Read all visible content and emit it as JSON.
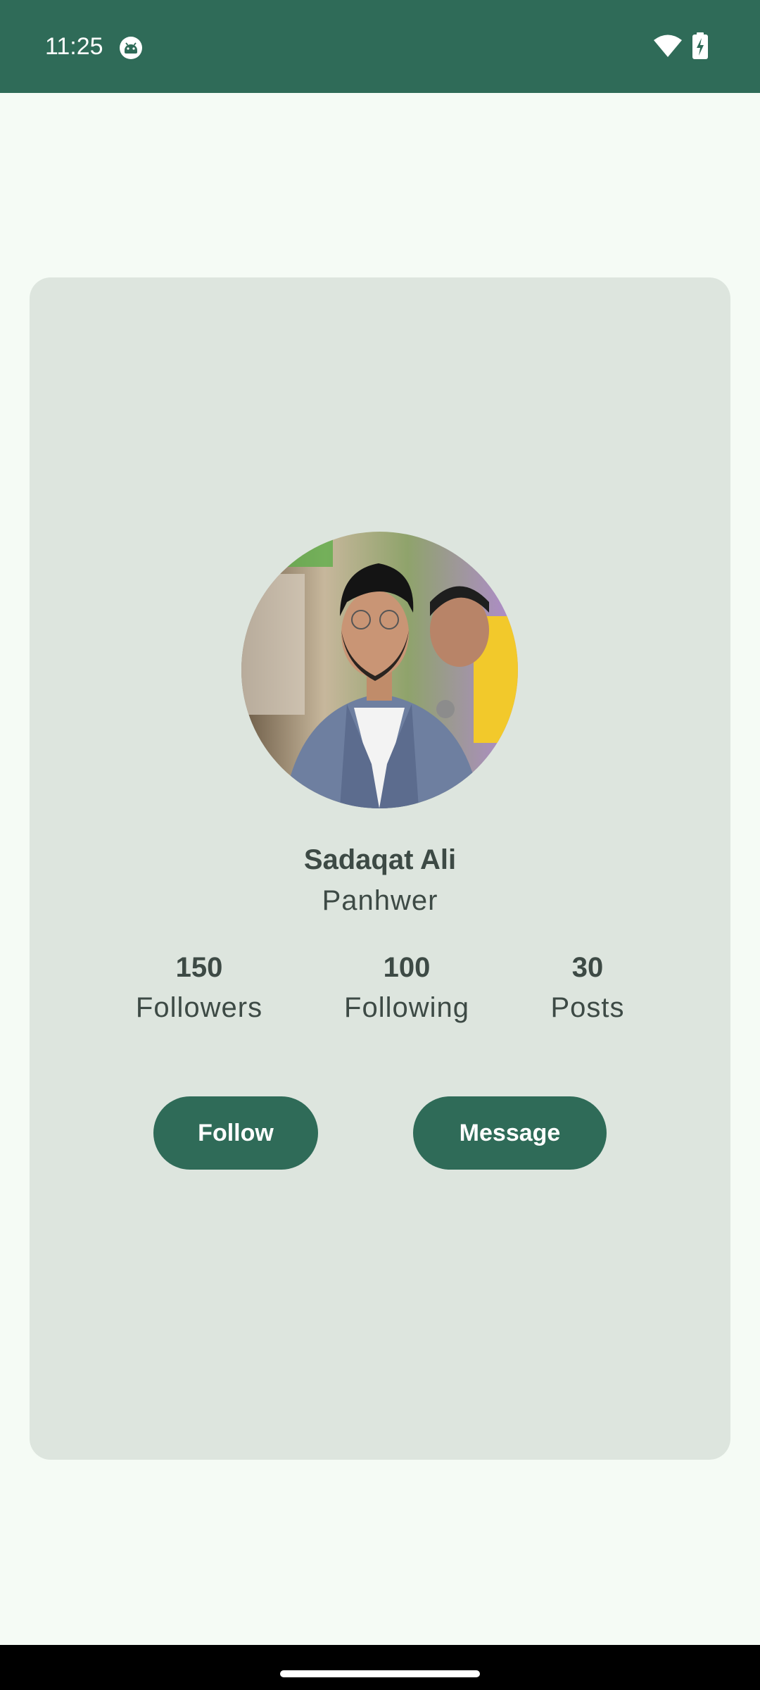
{
  "status_bar": {
    "time": "11:25",
    "app_icon": "android-robot-icon",
    "wifi_icon": "wifi-icon",
    "battery_icon": "battery-charging-icon"
  },
  "profile": {
    "first_name": "Sadaqat Ali",
    "last_name": "Panhwer",
    "avatar_alt": "profile-photo"
  },
  "stats": [
    {
      "value": "150",
      "label": "Followers"
    },
    {
      "value": "100",
      "label": "Following"
    },
    {
      "value": "30",
      "label": "Posts"
    }
  ],
  "actions": {
    "follow_label": "Follow",
    "message_label": "Message"
  },
  "colors": {
    "primary": "#2F6B58",
    "background": "#F5FBF5",
    "card": "#DDE5DE",
    "text": "#3D4A45"
  }
}
